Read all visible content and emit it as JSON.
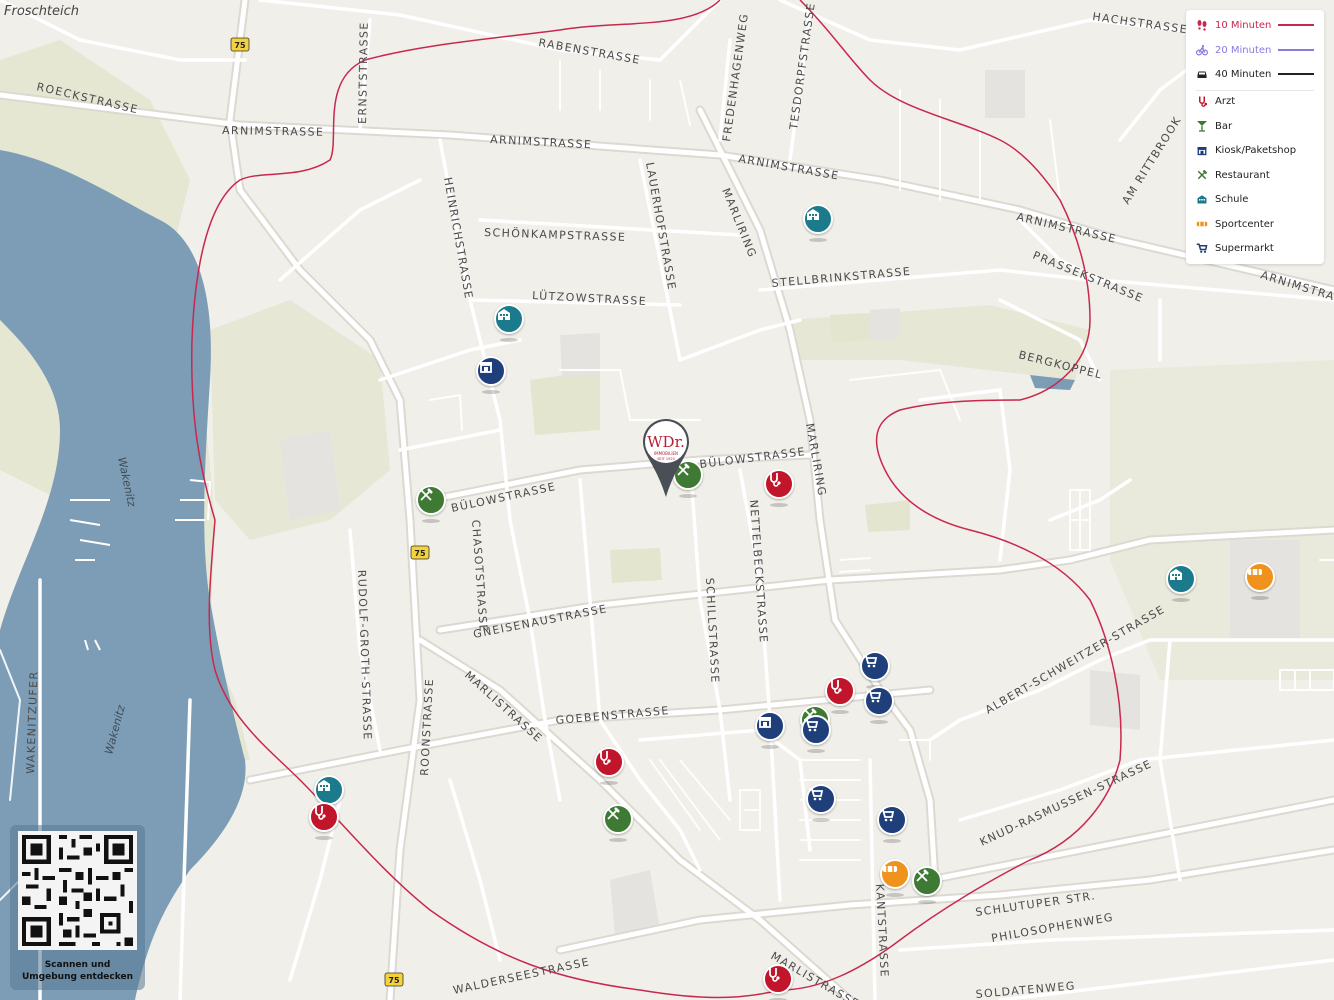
{
  "map": {
    "place_label": "Froschteich",
    "water_labels": [
      "Wakenitz",
      "Wakenitz"
    ],
    "route_shields": [
      "75",
      "75",
      "75"
    ],
    "streets": [
      "HACHSTRASSE",
      "RABENSTRASSE",
      "ERNSTSTRASSE",
      "FREDENHAGENWEG",
      "TESDORPFSTRASSE",
      "ROECKSTRASSE",
      "ARNIMSTRASSE",
      "ARNIMSTRASSE",
      "ARNIMSTRASSE",
      "ARNIMSTRASSE",
      "AM RITTBROOK",
      "HEINRICHSTRASSE",
      "SCHÖNKAMPSTRASSE",
      "LAUERHOFSTRASSE",
      "MARLIRING",
      "LÜTZOWSTRASSE",
      "STELLBRINKSTRASSE",
      "PRASSEKSTRASSE",
      "ARNIMSTRA",
      "BERGKOPPEL",
      "BÜLOWSTRASSE",
      "BÜLOWSTRASSE",
      "MARLIRING",
      "NETTELBECKSTRASSE",
      "CHASOTSTRASSE",
      "RUDOLF-GROTH-STRASSE",
      "GNEISENAUSTRASSE",
      "SCHILLSTRASSE",
      "ALBERT-SCHWEITZER-STRASSE",
      "ROONSTRASSE",
      "MARLISTRASSE",
      "GOEBENSTRASSE",
      "WAKENITZUFER",
      "KNUD-RASMUSSEN-STRASSE",
      "SCHLUTUPER STR.",
      "KANTSTRASSE",
      "PHILOSOPHENWEG",
      "WALDERSEESTRASSE",
      "MARLISTRASSE",
      "SOLDATENWEG"
    ]
  },
  "marker": {
    "logo_text": "WDr.",
    "logo_subtext": "IMMOBILIEN",
    "logo_since": "SEIT 1920"
  },
  "legend": {
    "isochrones": [
      {
        "label": "10 Minuten",
        "icon": "walk-icon",
        "color": "#c8284e"
      },
      {
        "label": "20 Minuten",
        "icon": "bike-icon",
        "color": "#8c78e0"
      },
      {
        "label": "40 Minuten",
        "icon": "car-icon",
        "color": "#222222"
      }
    ],
    "categories": [
      {
        "label": "Arzt",
        "icon": "doctor-icon",
        "color": "#c0152a"
      },
      {
        "label": "Bar",
        "icon": "bar-icon",
        "color": "#3a7a2a"
      },
      {
        "label": "Kiosk/Paketshop",
        "icon": "kiosk-icon",
        "color": "#1e3f7a"
      },
      {
        "label": "Restaurant",
        "icon": "restaurant-icon",
        "color": "#3f7a34"
      },
      {
        "label": "Schule",
        "icon": "school-icon",
        "color": "#1b7a8c"
      },
      {
        "label": "Sportcenter",
        "icon": "sport-icon",
        "color": "#f0921e"
      },
      {
        "label": "Supermarkt",
        "icon": "supermarket-icon",
        "color": "#1e3f7a"
      }
    ]
  },
  "qr": {
    "caption_line1": "Scannen und",
    "caption_line2": "Umgebung entdecken"
  }
}
